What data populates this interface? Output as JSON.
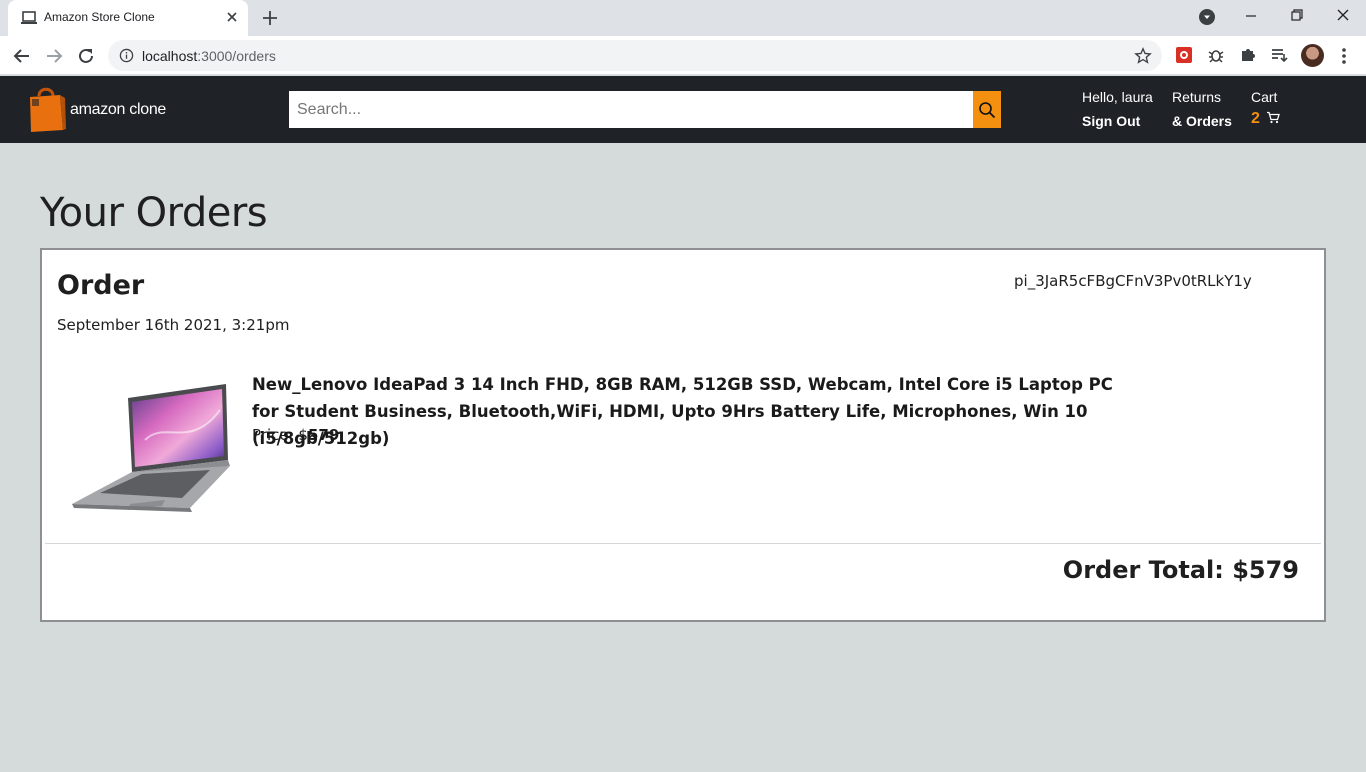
{
  "browser": {
    "tab_title": "Amazon Store Clone",
    "url_host": "localhost",
    "url_path": ":3000/orders"
  },
  "header": {
    "logo_text": "amazon clone",
    "search_placeholder": "Search...",
    "greeting": "Hello, laura",
    "sign_out": "Sign Out",
    "returns_line1": "Returns",
    "returns_line2": "& Orders",
    "cart_label": "Cart",
    "cart_count": "2",
    "accent_color": "#f3900f",
    "header_bg": "#1f2226"
  },
  "page": {
    "title": "Your Orders"
  },
  "order": {
    "heading": "Order",
    "id": "pi_3JaR5cFBgCFnV3Pv0tRLkY1y",
    "date": "September 16th 2021, 3:21pm",
    "item": {
      "title": "New_Lenovo IdeaPad 3 14 Inch FHD, 8GB RAM, 512GB SSD, Webcam, Intel Core i5 Laptop PC for Student Business, Bluetooth,WiFi, HDMI, Upto 9Hrs Battery Life, Microphones, Win 10 (i5/8gb/512gb)",
      "price_label": "Price: $",
      "price_value": "579",
      "image": "laptop-image"
    },
    "total": "Order Total: $579"
  }
}
